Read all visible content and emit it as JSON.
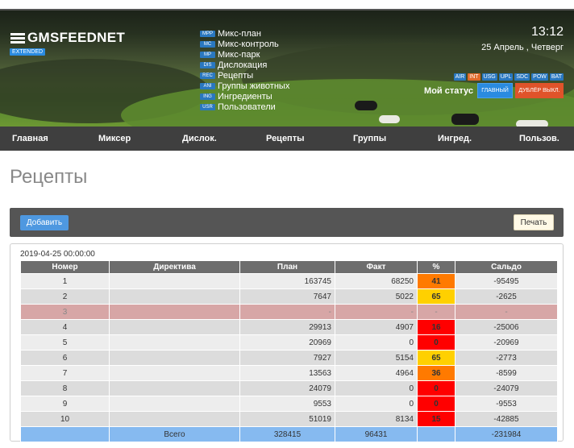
{
  "brand": {
    "name": "GMSFEEDNET",
    "badge": "EXTENDED"
  },
  "quicklinks": [
    {
      "tag": "MPP",
      "label": "Микс-план"
    },
    {
      "tag": "MC",
      "label": "Микс-контроль"
    },
    {
      "tag": "MP",
      "label": "Микс-парк"
    },
    {
      "tag": "DIS",
      "label": "Дислокация"
    },
    {
      "tag": "REC",
      "label": "Рецепты"
    },
    {
      "tag": "ANI",
      "label": "Группы животных"
    },
    {
      "tag": "ING",
      "label": "Ингредиенты"
    },
    {
      "tag": "USR",
      "label": "Пользователи"
    }
  ],
  "clock": {
    "time": "13:12",
    "date": "25 Апрель , Четверг"
  },
  "status_badges": [
    {
      "label": "AIR",
      "color": "#2a78c0"
    },
    {
      "label": "INT",
      "color": "#e06a2a"
    },
    {
      "label": "USG",
      "color": "#2a78c0"
    },
    {
      "label": "UPL",
      "color": "#2a78c0"
    },
    {
      "label": "SDC",
      "color": "#2a78c0"
    },
    {
      "label": "POW",
      "color": "#2a78c0"
    },
    {
      "label": "BAT",
      "color": "#2a78c0"
    }
  ],
  "my_status": {
    "label": "Мой статус",
    "main_button": "ГЛАВНЫЙ",
    "dubler_button": "ДУБЛЁР ВЫКЛ."
  },
  "nav": [
    "Главная",
    "Миксер",
    "Дислок.",
    "Рецепты",
    "Группы",
    "Ингред.",
    "Пользов."
  ],
  "page": {
    "title": "Рецепты"
  },
  "toolbar": {
    "add_label": "Добавить",
    "print_label": "Печать"
  },
  "panel": {
    "date": "2019-04-25 00:00:00",
    "columns": [
      "Номер",
      "Директива",
      "План",
      "Факт",
      "%",
      "Сальдо"
    ],
    "rows": [
      {
        "num": "1",
        "directive": "",
        "plan": "163745",
        "fact": "68250",
        "pct": "41",
        "pct_level": "orange",
        "saldo": "-95495"
      },
      {
        "num": "2",
        "directive": "",
        "plan": "7647",
        "fact": "5022",
        "pct": "65",
        "pct_level": "yellow",
        "saldo": "-2625"
      },
      {
        "num": "3",
        "directive": "",
        "plan": "-",
        "fact": "-",
        "pct": "-",
        "pct_level": "none",
        "saldo": "-"
      },
      {
        "num": "4",
        "directive": "",
        "plan": "29913",
        "fact": "4907",
        "pct": "16",
        "pct_level": "red",
        "saldo": "-25006"
      },
      {
        "num": "5",
        "directive": "",
        "plan": "20969",
        "fact": "0",
        "pct": "0",
        "pct_level": "red",
        "saldo": "-20969"
      },
      {
        "num": "6",
        "directive": "",
        "plan": "7927",
        "fact": "5154",
        "pct": "65",
        "pct_level": "yellow",
        "saldo": "-2773"
      },
      {
        "num": "7",
        "directive": "",
        "plan": "13563",
        "fact": "4964",
        "pct": "36",
        "pct_level": "orange",
        "saldo": "-8599"
      },
      {
        "num": "8",
        "directive": "",
        "plan": "24079",
        "fact": "0",
        "pct": "0",
        "pct_level": "red",
        "saldo": "-24079"
      },
      {
        "num": "9",
        "directive": "",
        "plan": "9553",
        "fact": "0",
        "pct": "0",
        "pct_level": "red",
        "saldo": "-9553"
      },
      {
        "num": "10",
        "directive": "",
        "plan": "51019",
        "fact": "8134",
        "pct": "15",
        "pct_level": "red",
        "saldo": "-42885"
      }
    ],
    "total": {
      "label": "Всего",
      "plan": "328415",
      "fact": "96431",
      "pct": "",
      "saldo": "-231984"
    }
  },
  "colors": {
    "nav_bg": "#3f3f3f",
    "accent_blue": "#2a8be0",
    "accent_orange": "#e0532a",
    "total_row": "#86baf0",
    "empty_row": "#d7a6a6"
  }
}
